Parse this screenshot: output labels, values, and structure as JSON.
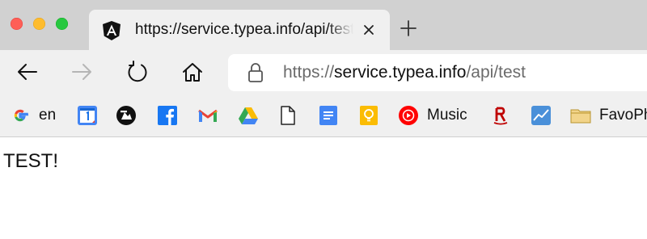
{
  "tab": {
    "title": "https://service.typea.info/api/test",
    "favicon": "angular-icon"
  },
  "url": {
    "scheme": "https://",
    "host": "service.typea.info",
    "path": "/api/test"
  },
  "bookmarks": [
    {
      "label": "en",
      "icon": "google-icon"
    },
    {
      "label": "",
      "icon": "google-calendar-icon"
    },
    {
      "label": "",
      "icon": "bookmark-logo-icon"
    },
    {
      "label": "",
      "icon": "facebook-icon"
    },
    {
      "label": "",
      "icon": "gmail-icon"
    },
    {
      "label": "",
      "icon": "google-drive-icon"
    },
    {
      "label": "",
      "icon": "document-icon"
    },
    {
      "label": "",
      "icon": "google-docs-icon"
    },
    {
      "label": "",
      "icon": "google-keep-icon"
    },
    {
      "label": "Music",
      "icon": "youtube-music-icon"
    },
    {
      "label": "",
      "icon": "rakuten-icon"
    },
    {
      "label": "",
      "icon": "stock-chart-icon"
    },
    {
      "label": "FavoPh",
      "icon": "folder-icon"
    }
  ],
  "page": {
    "text": "TEST!"
  },
  "colors": {
    "tabstrip": "#d1d1d1",
    "toolbar": "#f0f0f0",
    "traffic_red": "#fe5f57",
    "traffic_yellow": "#febc2e",
    "traffic_green": "#28c840"
  }
}
